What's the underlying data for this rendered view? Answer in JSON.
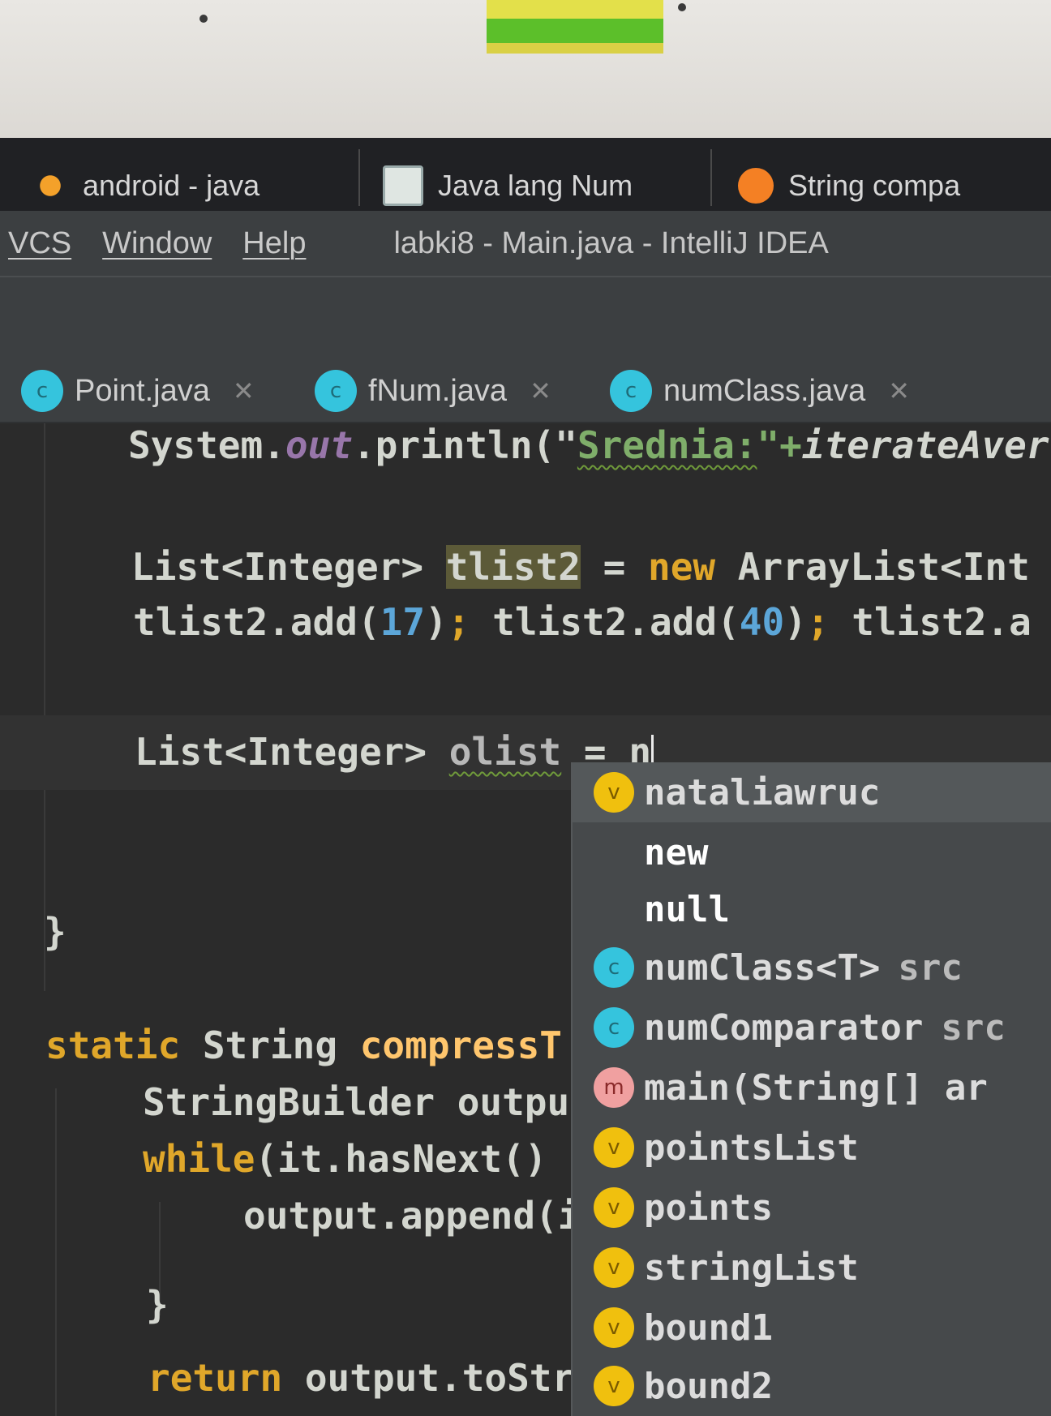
{
  "browser_tabs": [
    {
      "label": "android - java",
      "icon": "android-studio-icon"
    },
    {
      "label": "Java lang Num",
      "icon": "image-icon"
    },
    {
      "label": "String compa",
      "icon": "stackoverflow-icon"
    }
  ],
  "menu": {
    "items": [
      "VCS",
      "Window",
      "Help"
    ],
    "window_title": "labki8 - Main.java - IntelliJ IDEA"
  },
  "editor_tabs": [
    {
      "label": "Point.java",
      "icon": "class-icon",
      "icon_letter": "c"
    },
    {
      "label": "fNum.java",
      "icon": "class-icon",
      "icon_letter": "c"
    },
    {
      "label": "numClass.java",
      "icon": "class-icon",
      "icon_letter": "c"
    }
  ],
  "code": {
    "line1": {
      "a": "System.",
      "out": "out",
      "b": ".println(\"",
      "str": "Srednia:",
      "c": "\"+",
      "d": "iterateAver"
    },
    "line2": {
      "type": "List<Integer> ",
      "var": "tlist2",
      "eq": " = ",
      "kw": "new",
      "rest": " ArrayList<Int"
    },
    "line3": {
      "a": "tlist2.add(",
      "n1": "17",
      "b": ")",
      "semi1": ";",
      "c": " tlist2.add(",
      "n2": "40",
      "d": ")",
      "semi2": ";",
      "e": " tlist2.a"
    },
    "line4": {
      "type": "List<Integer> ",
      "var": "olist",
      "eq": " = ",
      "typed": "n"
    },
    "line5": {
      "brace": "}"
    },
    "line6": {
      "kw": "static",
      "type": " String ",
      "name": "compressT"
    },
    "line7": {
      "text": "StringBuilder outpu"
    },
    "line8": {
      "kw": "while",
      "rest": "(it.hasNext()"
    },
    "line9": {
      "text": "output.append(i"
    },
    "line10": {
      "brace": "}"
    },
    "line11": {
      "kw": "return",
      "rest": " output.toStr"
    }
  },
  "completion": [
    {
      "icon": "v",
      "icon_name": "variable-icon",
      "name": "nataliawruc",
      "type": "",
      "selected": true
    },
    {
      "icon": "",
      "icon_name": "keyword",
      "name": "new",
      "type": "",
      "keyword": true
    },
    {
      "icon": "",
      "icon_name": "keyword",
      "name": "null",
      "type": "",
      "keyword": true
    },
    {
      "icon": "c",
      "icon_name": "class-icon",
      "name": "numClass<T>",
      "type": "src"
    },
    {
      "icon": "c",
      "icon_name": "class-icon",
      "name": "numComparator",
      "type": "src"
    },
    {
      "icon": "m",
      "icon_name": "method-icon",
      "name": "main(String[] ar",
      "type": ""
    },
    {
      "icon": "v",
      "icon_name": "variable-icon",
      "name": "pointsList",
      "type": ""
    },
    {
      "icon": "v",
      "icon_name": "variable-icon",
      "name": "points",
      "type": ""
    },
    {
      "icon": "v",
      "icon_name": "variable-icon",
      "name": "stringList",
      "type": ""
    },
    {
      "icon": "v",
      "icon_name": "variable-icon",
      "name": "bound1",
      "type": ""
    },
    {
      "icon": "v",
      "icon_name": "variable-icon",
      "name": "bound2",
      "type": ""
    }
  ],
  "colors": {
    "keyword": "#e0a72a",
    "number": "#5ca6d8",
    "string": "#7fae6a",
    "class_icon": "#35c4dd",
    "variable_icon": "#f0c00e"
  }
}
